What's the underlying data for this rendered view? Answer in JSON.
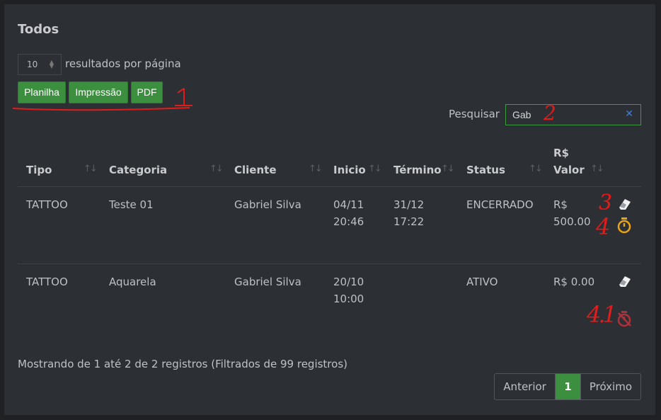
{
  "panel": {
    "title": "Todos"
  },
  "length_menu": {
    "value": "10",
    "label": "resultados por página"
  },
  "export_buttons": {
    "planilha": "Planilha",
    "impressao": "Impressão",
    "pdf": "PDF"
  },
  "search": {
    "label": "Pesquisar",
    "value": "Gab"
  },
  "table": {
    "headers": {
      "tipo": "Tipo",
      "categoria": "Categoria",
      "cliente": "Cliente",
      "inicio": "Inicio",
      "termino": "Término",
      "status": "Status",
      "valor_line1": "R$",
      "valor_line2": "Valor",
      "sort_glyph": "↑↓"
    },
    "rows": [
      {
        "tipo": "TATTOO",
        "categoria": "Teste 01",
        "cliente": "Gabriel Silva",
        "inicio_date": "04/11",
        "inicio_time": "20:46",
        "termino_date": "31/12",
        "termino_time": "17:22",
        "status": "ENCERRADO",
        "valor_line1": "R$",
        "valor_line2": "500.00",
        "icons": [
          "eraser-icon",
          "stopwatch-icon"
        ]
      },
      {
        "tipo": "TATTOO",
        "categoria": "Aquarela",
        "cliente": "Gabriel Silva",
        "inicio_date": "20/10",
        "inicio_time": "10:00",
        "termino_date": "",
        "termino_time": "",
        "status": "ATIVO",
        "valor_line1": "R$ 0.00",
        "valor_line2": "",
        "icons": [
          "eraser-icon",
          "stopwatch-off-icon"
        ]
      }
    ]
  },
  "info": "Mostrando de 1 até 2 de 2 registros (Filtrados de 99 registros)",
  "pagination": {
    "previous": "Anterior",
    "current": "1",
    "next": "Próximo"
  },
  "annotations": {
    "a1": "1",
    "a2": "2",
    "a3": "3",
    "a4": "4",
    "a41": "4.1"
  },
  "colors": {
    "accent": "#3c8f3f",
    "annotation": "#e21b1b",
    "timer": "#e8a317",
    "timer_off": "#b0303a"
  }
}
